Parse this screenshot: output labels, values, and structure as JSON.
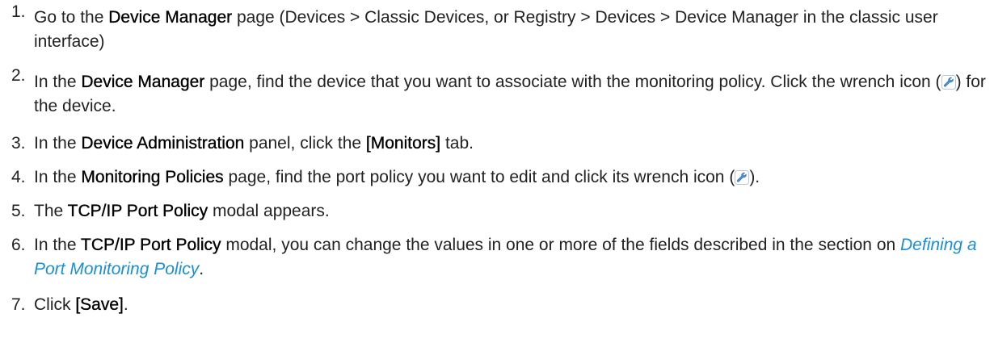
{
  "steps": [
    {
      "num": "1.",
      "parts": [
        {
          "t": "Go to the "
        },
        {
          "t": "Device Manager",
          "b": true
        },
        {
          "t": " page (Devices > Classic Devices, or Registry > Devices > Device Manager in the classic user interface)"
        }
      ]
    },
    {
      "num": "2.",
      "parts": [
        {
          "t": "In the "
        },
        {
          "t": "Device Manager",
          "b": true
        },
        {
          "t": " page, find the device that you want to associate with the monitoring policy. Click the wrench icon ("
        },
        {
          "icon": "wrench-icon"
        },
        {
          "t": ") for the device."
        }
      ]
    },
    {
      "num": "3.",
      "parts": [
        {
          "t": "In the "
        },
        {
          "t": "Device Administration",
          "b": true
        },
        {
          "t": " panel, click the "
        },
        {
          "t": "[Monitors]",
          "b": true
        },
        {
          "t": " tab."
        }
      ]
    },
    {
      "num": "4.",
      "parts": [
        {
          "t": "In the "
        },
        {
          "t": "Monitoring Policies",
          "b": true
        },
        {
          "t": " page, find the port policy you want to edit and click its wrench icon ("
        },
        {
          "icon": "wrench-icon"
        },
        {
          "t": ")."
        }
      ]
    },
    {
      "num": "5.",
      "parts": [
        {
          "t": "The "
        },
        {
          "t": "TCP/IP Port Policy",
          "b": true
        },
        {
          "t": " modal appears."
        }
      ]
    },
    {
      "num": "6.",
      "parts": [
        {
          "t": "In the "
        },
        {
          "t": "TCP/IP Port Policy",
          "b": true
        },
        {
          "t": " modal, you can change the values in one or more of the fields described in the section on "
        },
        {
          "t": "Defining a Port Monitoring Policy",
          "link": true
        },
        {
          "t": "."
        }
      ]
    },
    {
      "num": "7.",
      "parts": [
        {
          "t": "Click "
        },
        {
          "t": "[Save]",
          "b": true
        },
        {
          "t": "."
        }
      ]
    }
  ],
  "colors": {
    "text": "#222222",
    "link": "#1a8fd6",
    "icon_fill": "#4a90d9"
  }
}
